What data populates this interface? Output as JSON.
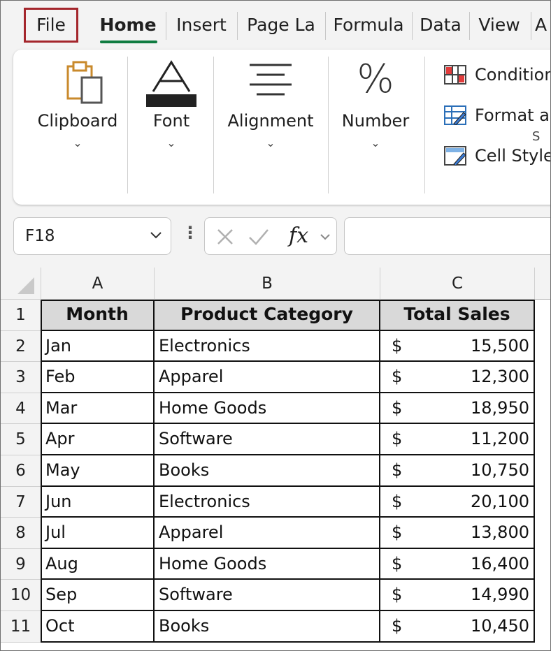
{
  "tabs": [
    "File",
    "Home",
    "Insert",
    "Page La",
    "Formula",
    "Data",
    "View",
    "A"
  ],
  "ribbon": {
    "groups": [
      "Clipboard",
      "Font",
      "Alignment",
      "Number"
    ],
    "number_icon": "%",
    "styles_items": [
      "Condition",
      "Format a",
      "Cell Style"
    ],
    "styles_group_label": "S"
  },
  "formula_bar": {
    "name_box": "F18",
    "fx_label": "fx",
    "formula_value": ""
  },
  "sheet": {
    "columns": [
      "A",
      "B",
      "C"
    ],
    "header_row": [
      "Month",
      "Product Category",
      "Total Sales"
    ],
    "currency_symbol": "$",
    "rows": [
      {
        "num": "1"
      },
      {
        "num": "2",
        "month": "Jan",
        "category": "Electronics",
        "sales": "15,500"
      },
      {
        "num": "3",
        "month": "Feb",
        "category": "Apparel",
        "sales": "12,300"
      },
      {
        "num": "4",
        "month": "Mar",
        "category": "Home Goods",
        "sales": "18,950"
      },
      {
        "num": "5",
        "month": "Apr",
        "category": "Software",
        "sales": "11,200"
      },
      {
        "num": "6",
        "month": "May",
        "category": "Books",
        "sales": "10,750"
      },
      {
        "num": "7",
        "month": "Jun",
        "category": "Electronics",
        "sales": "20,100"
      },
      {
        "num": "8",
        "month": "Jul",
        "category": "Apparel",
        "sales": "13,800"
      },
      {
        "num": "9",
        "month": "Aug",
        "category": "Home Goods",
        "sales": "16,400"
      },
      {
        "num": "10",
        "month": "Sep",
        "category": "Software",
        "sales": "14,990"
      },
      {
        "num": "11",
        "month": "Oct",
        "category": "Books",
        "sales": "10,450"
      }
    ]
  },
  "colors": {
    "file_tab_border": "#a4262c",
    "home_underline": "#107c41",
    "header_fill": "#d9d9d9"
  }
}
